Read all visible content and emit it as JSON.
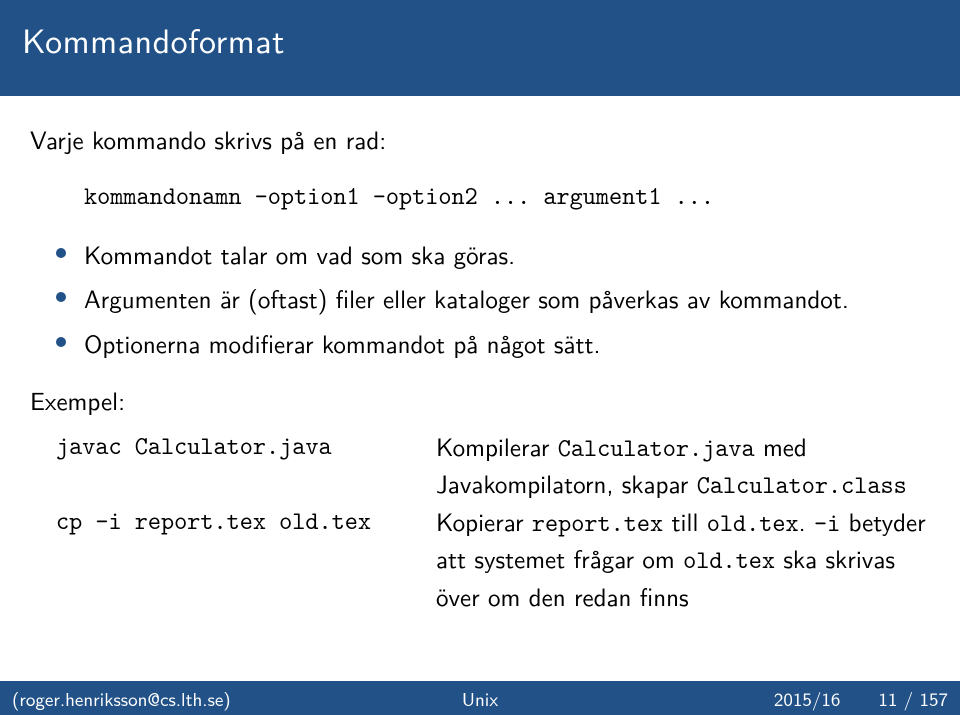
{
  "title": "Kommandoformat",
  "intro": "Varje kommando skrivs på en rad:",
  "command_line": "kommandonamn -option1 -option2 ... argument1 ...",
  "bullets": [
    "Kommandot talar om vad som ska göras.",
    "Argumenten är (oftast) filer eller kataloger som påverkas av kommandot.",
    "Optionerna modifierar kommandot på något sätt."
  ],
  "example_label": "Exempel:",
  "examples": [
    {
      "cmd": "javac Calculator.java",
      "desc_parts": [
        {
          "t": "Kompilerar ",
          "tt": false
        },
        {
          "t": "Calculator.java",
          "tt": true
        },
        {
          "t": " med Javakompilatorn, skapar ",
          "tt": false
        },
        {
          "t": "Calculator.class",
          "tt": true
        }
      ]
    },
    {
      "cmd": "cp -i report.tex old.tex",
      "desc_parts": [
        {
          "t": "Kopierar ",
          "tt": false
        },
        {
          "t": "report.tex",
          "tt": true
        },
        {
          "t": " till ",
          "tt": false
        },
        {
          "t": "old.tex",
          "tt": true
        },
        {
          "t": ". ",
          "tt": false
        },
        {
          "t": "-i",
          "tt": true
        },
        {
          "t": " betyder att systemet frågar om ",
          "tt": false
        },
        {
          "t": "old.tex",
          "tt": true
        },
        {
          "t": " ska skrivas över om den redan finns",
          "tt": false
        }
      ]
    }
  ],
  "footer": {
    "author": "(roger.henriksson@cs.lth.se)",
    "course": "Unix",
    "term": "2015/16",
    "page": "11 / 157"
  }
}
